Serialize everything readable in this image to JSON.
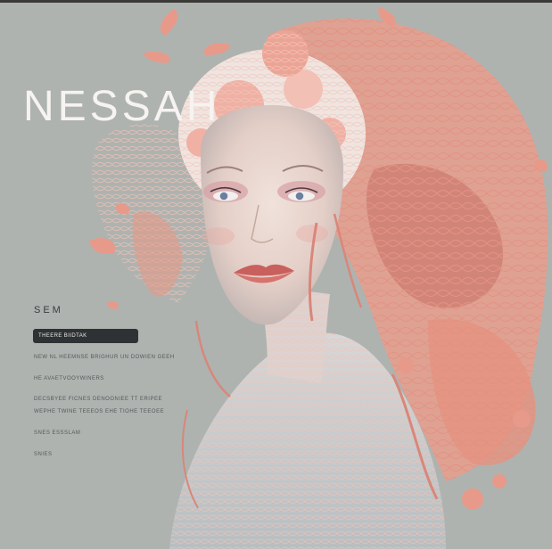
{
  "brand": {
    "title": "NESSAH"
  },
  "section": {
    "heading": "SEM"
  },
  "cta": {
    "label": "THEERE BIIDTAK"
  },
  "menu": {
    "items": [
      "NEW NL HEEMNSE BRIGHUR UN DOWIEN GEEH",
      "HE AVAETVOOYWINERS",
      "DECSBYEE FICNES DENOONIEE TT ERIPEE",
      "WEPHE TWINE TEEEOS EHE TIOHE TEEOEE",
      "SNES ESSSLAM",
      "SNIES"
    ]
  },
  "colors": {
    "background": "#aeb3b0",
    "coral": "#e79a8a",
    "coral_light": "#f1b8aa",
    "skin": "#e8d8d0",
    "dark": "#2f3234"
  }
}
